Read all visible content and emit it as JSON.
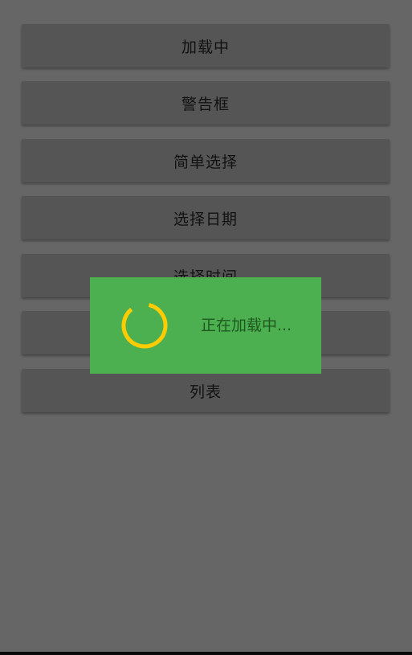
{
  "buttons": [
    {
      "label": "加载中"
    },
    {
      "label": "警告框"
    },
    {
      "label": "简单选择"
    },
    {
      "label": "选择日期"
    },
    {
      "label": "选择时间"
    },
    {
      "label": ""
    },
    {
      "label": "列表"
    }
  ],
  "dialog": {
    "message": "正在加载中...",
    "spinner_icon": "loading-spinner-icon"
  },
  "colors": {
    "scrim_background": "#666666",
    "button_background": "#555555",
    "dialog_background": "#4caf50",
    "spinner": "#ffcc00",
    "dialog_text": "#1e5a20"
  }
}
